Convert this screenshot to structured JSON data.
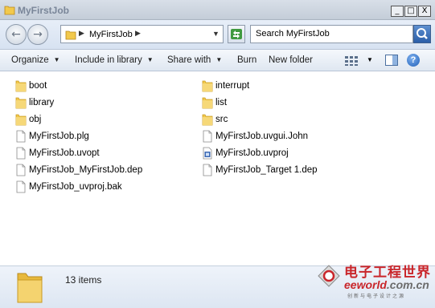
{
  "window": {
    "title": "MyFirstJob",
    "controls": {
      "minimize": "_",
      "maximize": "□",
      "close": "X"
    }
  },
  "address": {
    "crumb": "MyFirstJob",
    "search_placeholder": "Search MyFirstJob"
  },
  "toolbar": {
    "organize": "Organize",
    "include": "Include in library",
    "share": "Share with",
    "burn": "Burn",
    "new_folder": "New folder",
    "help": "?"
  },
  "files": [
    {
      "name": "boot",
      "type": "folder"
    },
    {
      "name": "library",
      "type": "folder"
    },
    {
      "name": "obj",
      "type": "folder"
    },
    {
      "name": "MyFirstJob.plg",
      "type": "file"
    },
    {
      "name": "MyFirstJob.uvopt",
      "type": "file"
    },
    {
      "name": "MyFirstJob_MyFirstJob.dep",
      "type": "file"
    },
    {
      "name": "MyFirstJob_uvproj.bak",
      "type": "file"
    },
    {
      "name": "interrupt",
      "type": "folder"
    },
    {
      "name": "list",
      "type": "folder"
    },
    {
      "name": "src",
      "type": "folder"
    },
    {
      "name": "MyFirstJob.uvgui.John",
      "type": "file"
    },
    {
      "name": "MyFirstJob.uvproj",
      "type": "project"
    },
    {
      "name": "MyFirstJob_Target 1.dep",
      "type": "file"
    }
  ],
  "status": {
    "item_count": "13 items"
  },
  "watermark": {
    "cn": "电子工程世界",
    "en_prefix": "eeworld",
    "en_suffix": ".com.cn",
    "sub": "创新与电子设计之源"
  },
  "colors": {
    "folder": "#f2c94c",
    "folder_dark": "#d9a520",
    "accent_blue": "#2a5ea8",
    "watermark_red": "#c9262b"
  }
}
